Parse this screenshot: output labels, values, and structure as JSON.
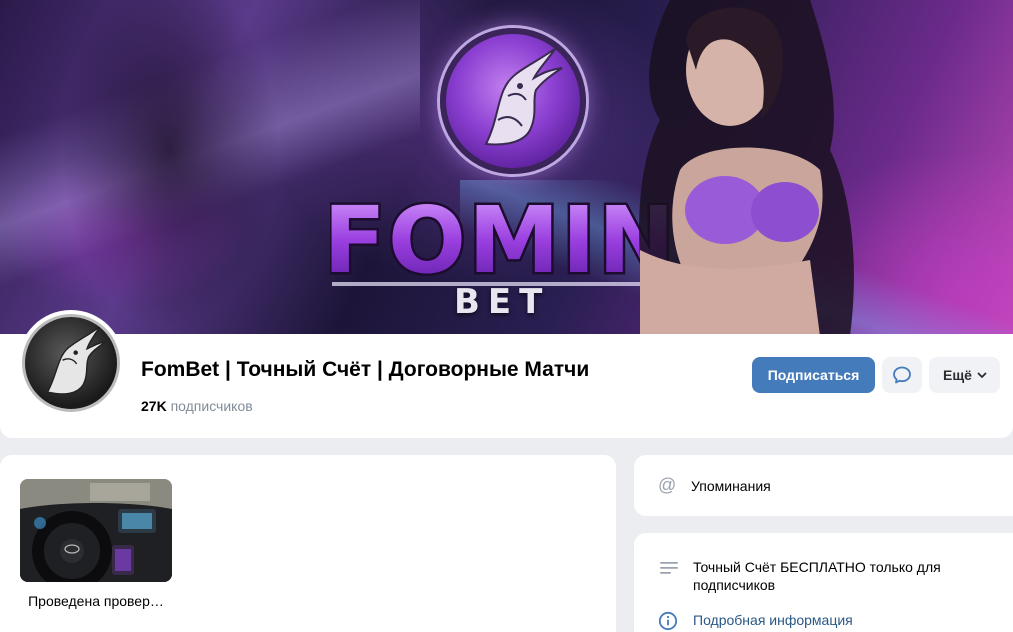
{
  "cover": {
    "logo_word": "FOMIN",
    "logo_sub": "BET"
  },
  "group": {
    "title": "FomBet | Точный Счёт | Договорные Матчи",
    "subscribers_count": "27K",
    "subscribers_label": "подписчиков"
  },
  "actions": {
    "subscribe_label": "Подписаться",
    "message_icon": "chat-bubble-icon",
    "more_label": "Ещё"
  },
  "wall": {
    "thumbnail_caption": "Проведена провер…"
  },
  "sidebar": {
    "mentions_label": "Упоминания",
    "mentions_icon": "@",
    "description": "Точный Счёт БЕСПЛАТНО только для подписчиков",
    "details_link": "Подробная информация"
  },
  "colors": {
    "accent": "#447bba",
    "link": "#2a5885",
    "muted": "#818c99"
  }
}
